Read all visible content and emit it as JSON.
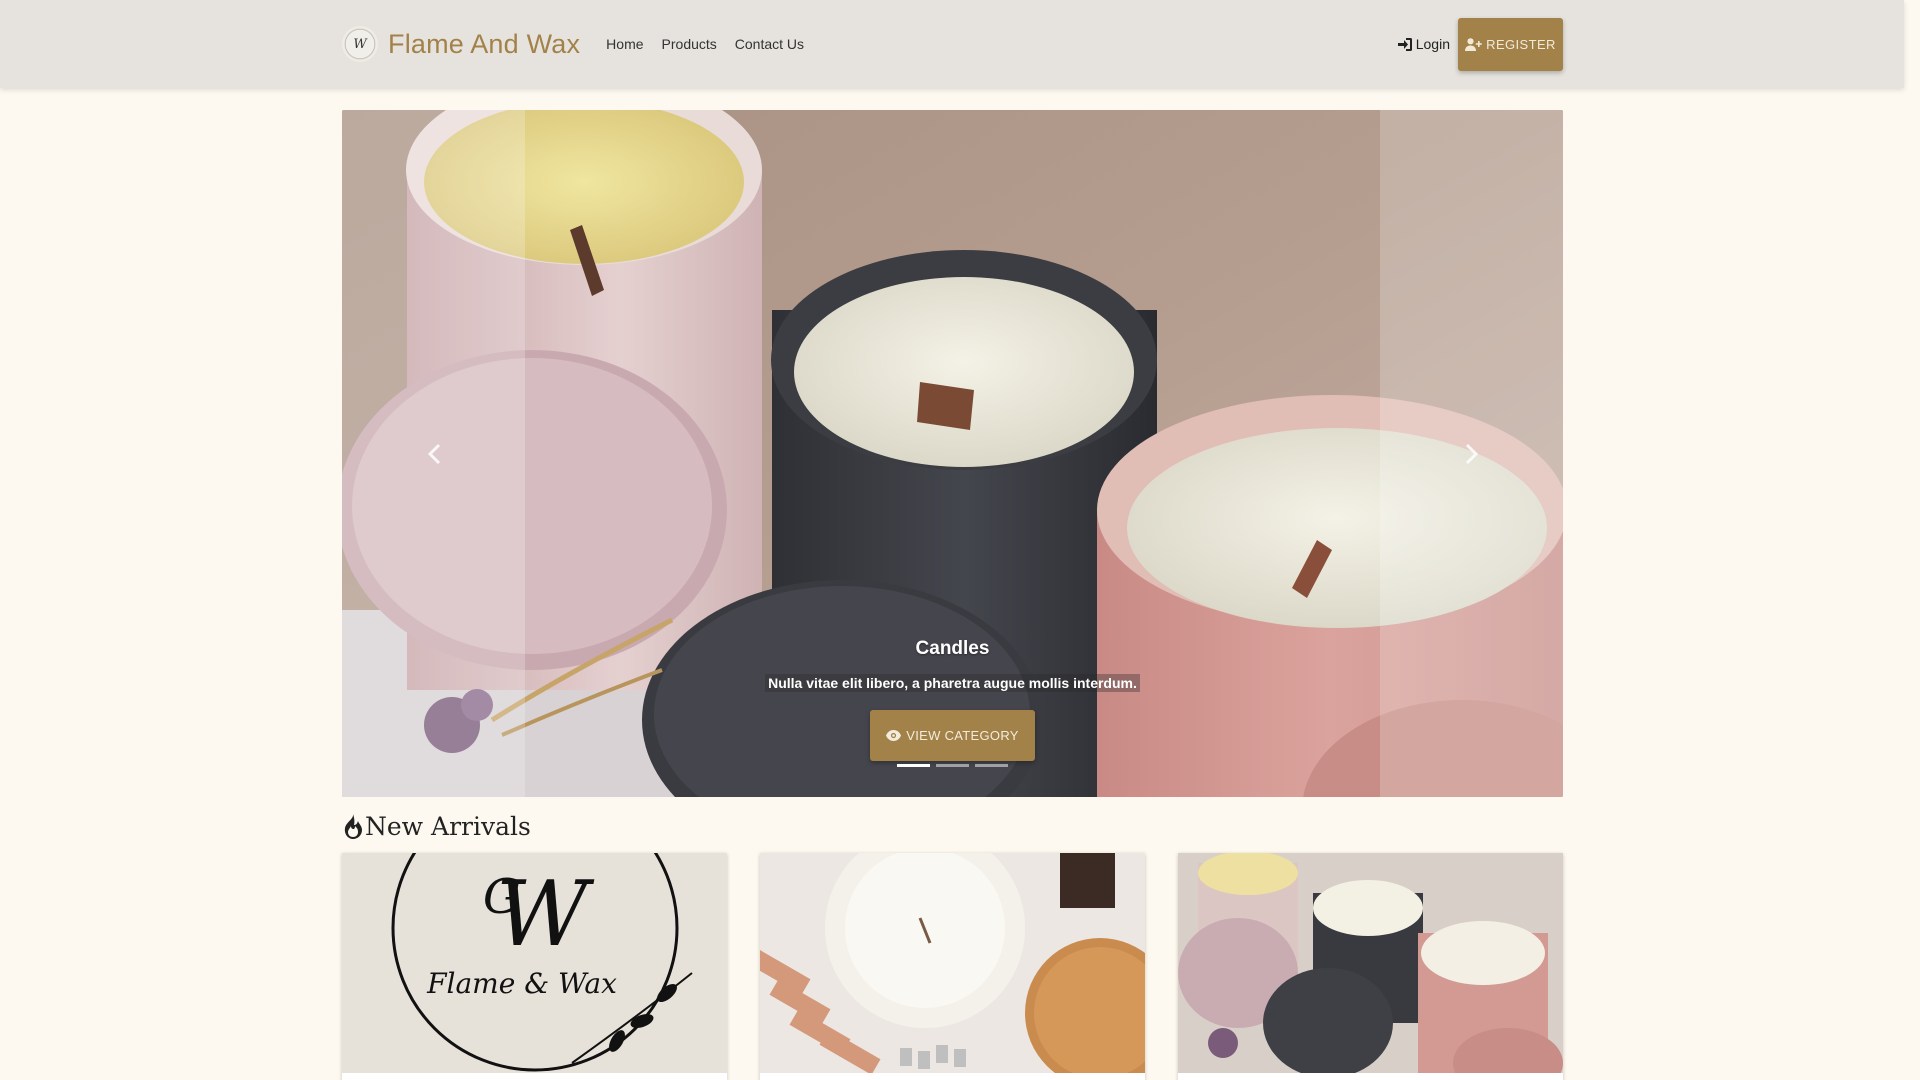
{
  "nav": {
    "brand": "Flame And Wax",
    "links": [
      "Home",
      "Products",
      "Contact Us"
    ],
    "login": "Login",
    "register": "REGISTER"
  },
  "carousel": {
    "caption_title": "Candles",
    "caption_text": "Nulla vitae elit libero, a pharetra augue mollis interdum.",
    "button": "VIEW CATEGORY",
    "slide_count": 3,
    "active_slide": 1
  },
  "section": {
    "title": "New Arrivals"
  },
  "cards": {
    "logo_text": "Flame & Wax"
  },
  "colors": {
    "accent": "#a3824a",
    "navbar_bg": "#e6e3de",
    "page_bg": "#fdf9f0"
  }
}
